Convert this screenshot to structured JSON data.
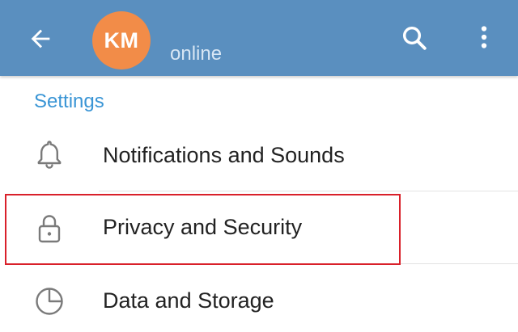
{
  "header": {
    "avatar_initials": "KM",
    "avatar_color": "#f28c48",
    "status": "online",
    "background_color": "#5a8fbf",
    "back_icon": "arrow-left-icon",
    "search_icon": "search-icon",
    "more_icon": "more-vertical-icon"
  },
  "settings": {
    "section_title": "Settings",
    "accent_color": "#3a95d5",
    "items": [
      {
        "label": "Notifications and Sounds",
        "icon": "bell-icon"
      },
      {
        "label": "Privacy and Security",
        "icon": "lock-icon"
      },
      {
        "label": "Data and Storage",
        "icon": "pie-chart-icon"
      }
    ]
  },
  "highlight_color": "#d9202a"
}
